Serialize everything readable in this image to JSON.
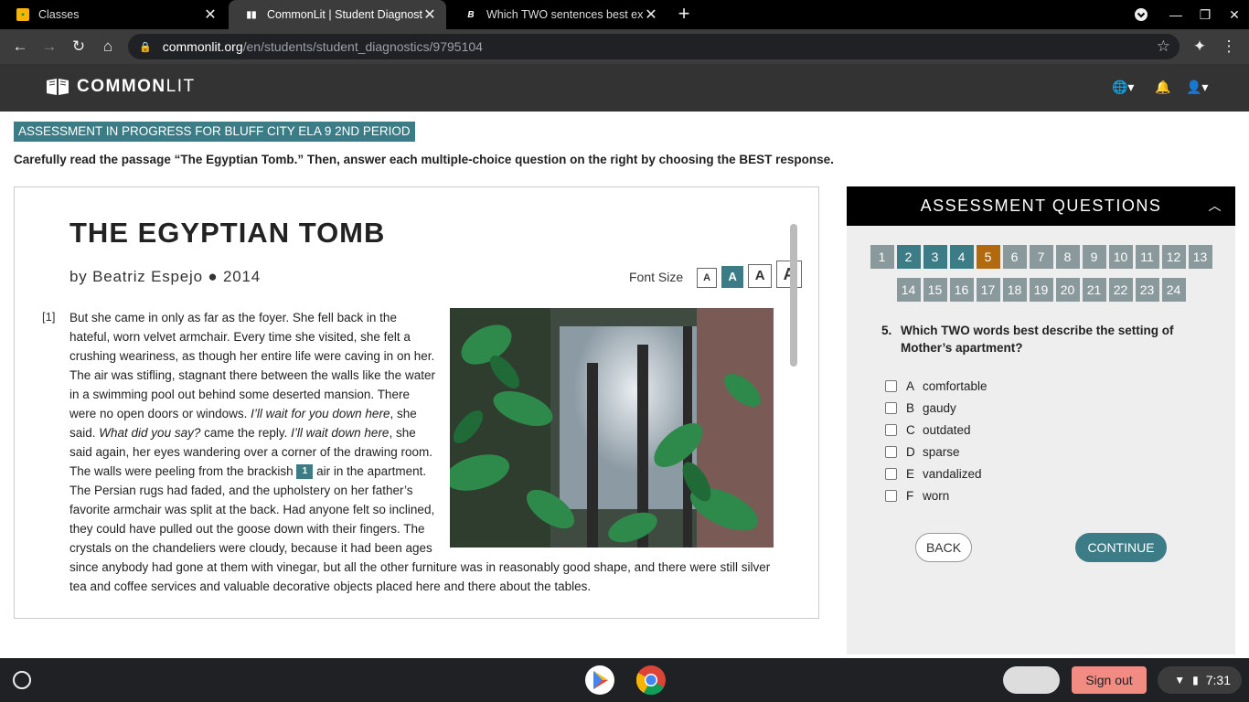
{
  "browser": {
    "tabs": [
      {
        "title": "Classes",
        "active": false
      },
      {
        "title": "CommonLit | Student Diagnostic",
        "active": true
      },
      {
        "title": "Which TWO sentences best expr",
        "active": false
      }
    ],
    "url_host": "commonlit.org",
    "url_path": "/en/students/student_diagnostics/9795104"
  },
  "site": {
    "logo_bold": "COMMON",
    "logo_light": "LIT"
  },
  "banner": "ASSESSMENT IN PROGRESS FOR BLUFF CITY ELA 9 2ND PERIOD",
  "instructions": "Carefully read the passage “The Egyptian Tomb.” Then, answer each multiple-choice question on the right by choosing the BEST response.",
  "passage": {
    "title": "THE EGYPTIAN TOMB",
    "byline": "by Beatriz Espejo ● 2014",
    "font_size_label": "Font Size",
    "font_size_options": [
      "A",
      "A",
      "A",
      "A"
    ],
    "paragraph_number": "[1]",
    "footnote": "1",
    "p1": "But she came in only as far as the foyer. She fell back in the hateful, worn velvet armchair. Every time she visited, she felt a crushing weariness, as though her entire life were caving in on her. The air was stifling, stagnant there between the walls like the water in a swimming pool out behind some deserted mansion. There were no open doors or windows. ",
    "i1": "I’ll wait for you down here",
    "p2": ", she said. ",
    "i2": "What did you say?",
    "p3": " came the reply. ",
    "i3": "I’ll wait down here",
    "p4": ", she said again, her eyes wandering over a corner of the drawing room. The walls were peeling from the brackish ",
    "p5": " air in the apartment. The Persian rugs had faded, and the upholstery on her father’s favorite armchair was split at the back. Had anyone felt so inclined, they could have pulled out the goose down with their fingers. The crystals on the chandeliers were cloudy, because it had been ages since anybody had gone at them with vinegar, but all the other furniture was in reasonably good shape, and there were still silver tea and coffee services and valuable decorative objects placed here and there about the tables."
  },
  "questions": {
    "header": "ASSESSMENT QUESTIONS",
    "row1": [
      "1",
      "2",
      "3",
      "4",
      "5",
      "6",
      "7",
      "8",
      "9",
      "10",
      "11",
      "12",
      "13"
    ],
    "row2": [
      "14",
      "15",
      "16",
      "17",
      "18",
      "19",
      "20",
      "21",
      "22",
      "23",
      "24"
    ],
    "answered": [
      "2",
      "3",
      "4"
    ],
    "current": "5",
    "question_number": "5.",
    "question_text": "Which TWO words best describe the setting of Mother’s apartment?",
    "choices": [
      {
        "letter": "A",
        "text": "comfortable"
      },
      {
        "letter": "B",
        "text": "gaudy"
      },
      {
        "letter": "C",
        "text": "outdated"
      },
      {
        "letter": "D",
        "text": "sparse"
      },
      {
        "letter": "E",
        "text": "vandalized"
      },
      {
        "letter": "F",
        "text": "worn"
      }
    ],
    "back_label": "BACK",
    "continue_label": "CONTINUE"
  },
  "shelf": {
    "sign_out": "Sign out",
    "time": "7:31"
  },
  "colors": {
    "accent": "#3c7c86",
    "current": "#b36a0f",
    "unanswered": "#8a9a9c"
  }
}
